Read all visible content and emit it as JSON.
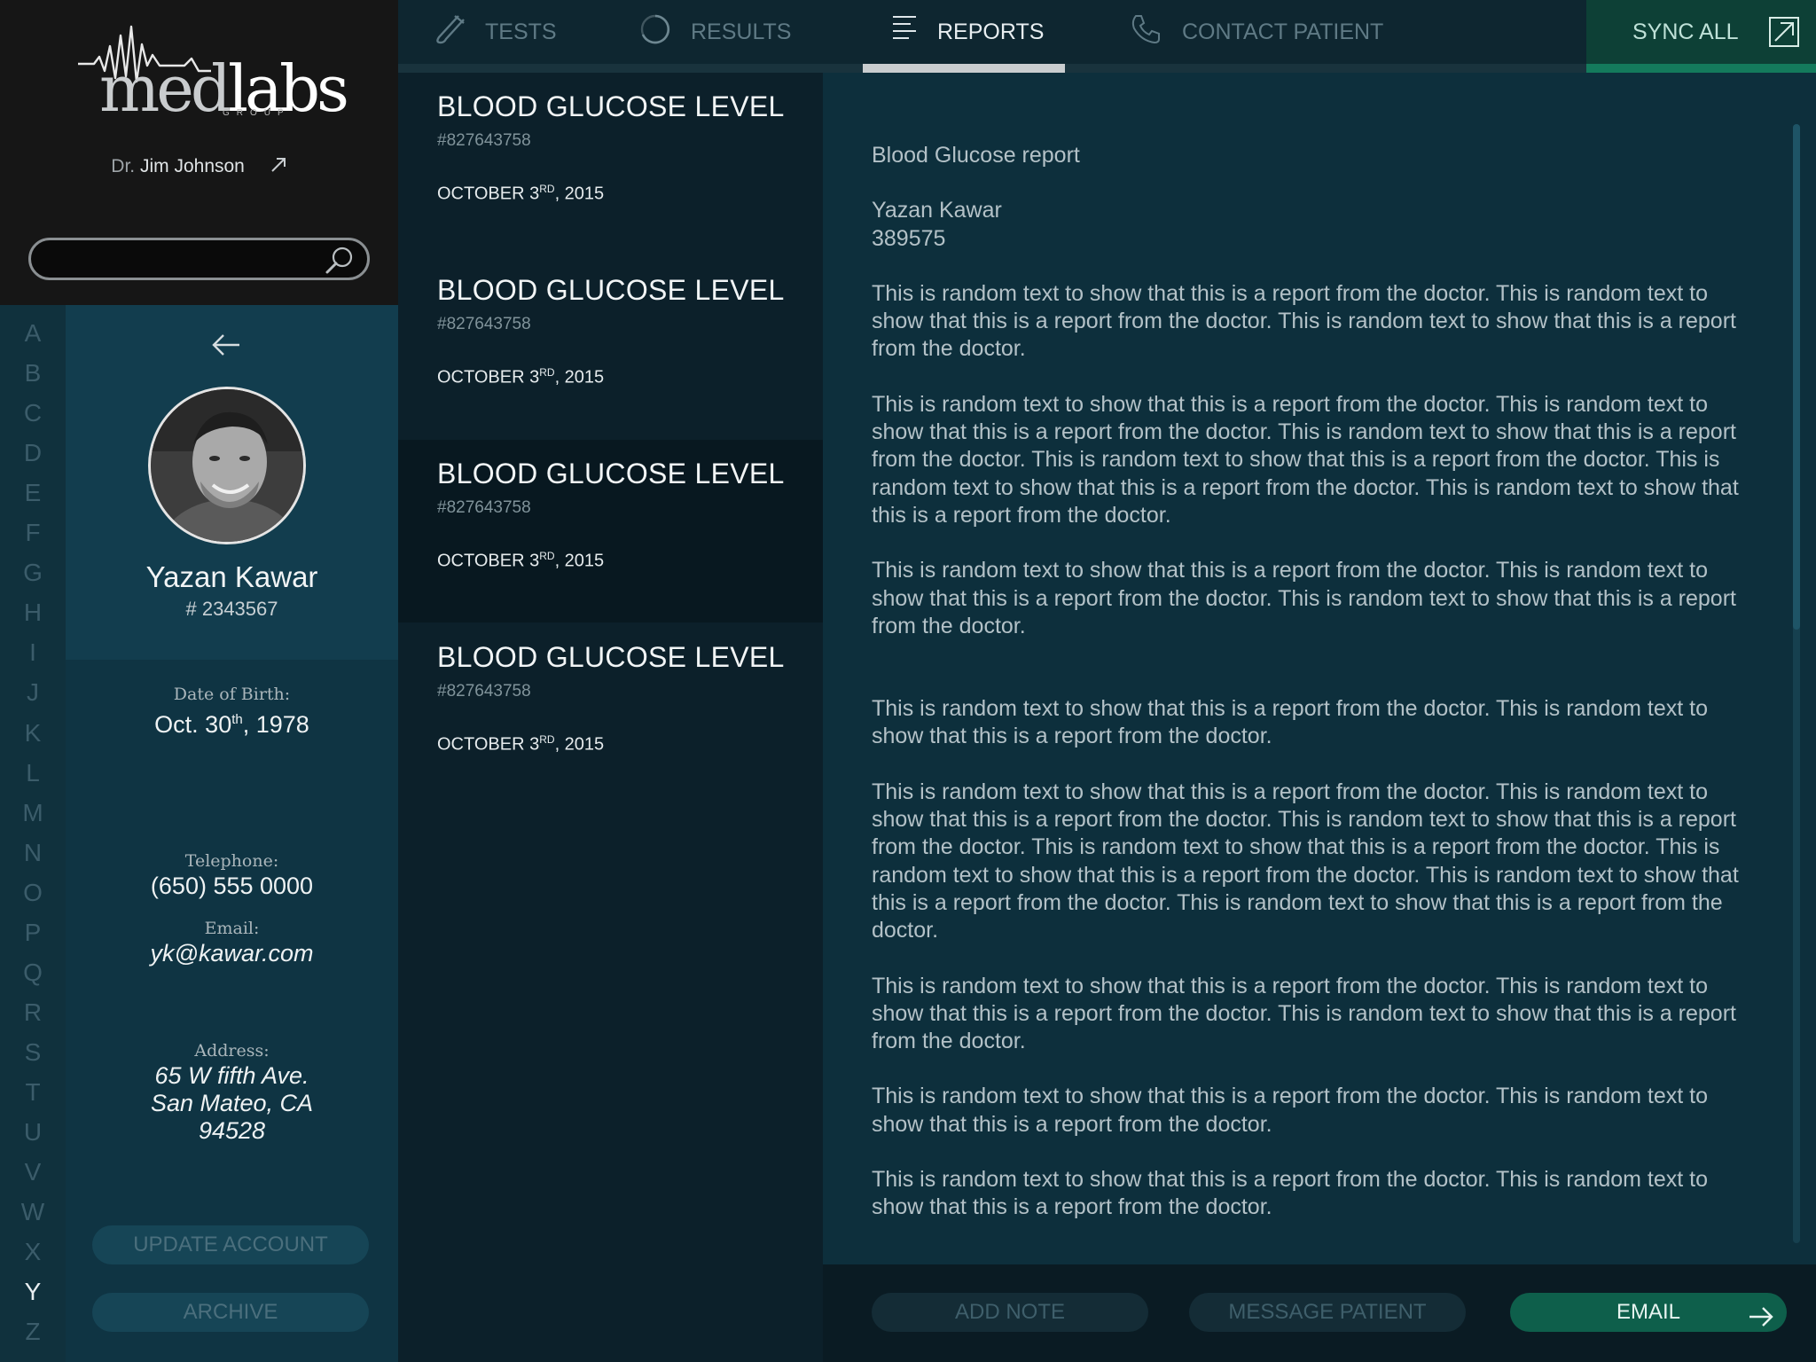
{
  "brand": {
    "logo_primary": "med",
    "logo_secondary": "labs",
    "logo_sub": "GROUP",
    "doctor_prefix": "Dr.",
    "doctor_name": "Jim Johnson",
    "search_placeholder": "",
    "search_value": ""
  },
  "alphabet": {
    "letters": [
      "A",
      "B",
      "C",
      "D",
      "E",
      "F",
      "G",
      "H",
      "I",
      "J",
      "K",
      "L",
      "M",
      "N",
      "O",
      "P",
      "Q",
      "R",
      "S",
      "T",
      "U",
      "V",
      "W",
      "X",
      "Y",
      "Z"
    ],
    "active": "Y"
  },
  "patient": {
    "name": "Yazan Kawar",
    "id": "# 2343567",
    "dob_label": "Date of Birth:",
    "dob_day": "Oct. 30",
    "dob_sup": "th",
    "dob_year": ", 1978",
    "phone_label": "Telephone:",
    "phone": "(650) 555 0000",
    "email_label": "Email:",
    "email": "yk@kawar.com",
    "address_label": "Address:",
    "address_line1": "65 W fifth Ave.",
    "address_line2": "San Mateo, CA",
    "address_line3": "94528",
    "update_button": "UPDATE ACCOUNT",
    "archive_button": "ARCHIVE"
  },
  "nav": {
    "tabs": [
      {
        "label": "TESTS",
        "icon": "test-tube-icon"
      },
      {
        "label": "RESULTS",
        "icon": "progress-ring-icon"
      },
      {
        "label": "REPORTS",
        "icon": "document-lines-icon"
      },
      {
        "label": "CONTACT PATIENT",
        "icon": "phone-icon"
      }
    ],
    "active": "REPORTS",
    "sync_label": "SYNC ALL"
  },
  "reports": [
    {
      "title": "BLOOD GLUCOSE LEVEL",
      "id": "#827643758",
      "date_day": "OCTOBER 3",
      "date_sup": "RD",
      "date_year": ", 2015",
      "active": false
    },
    {
      "title": "BLOOD GLUCOSE LEVEL",
      "id": "#827643758",
      "date_day": "OCTOBER 3",
      "date_sup": "RD",
      "date_year": ", 2015",
      "active": false
    },
    {
      "title": "BLOOD GLUCOSE LEVEL",
      "id": "#827643758",
      "date_day": "OCTOBER 3",
      "date_sup": "RD",
      "date_year": ", 2015",
      "active": true
    },
    {
      "title": "BLOOD GLUCOSE LEVEL",
      "id": "#827643758",
      "date_day": "OCTOBER 3",
      "date_sup": "RD",
      "date_year": ", 2015",
      "active": false
    }
  ],
  "detail": {
    "heading": "Blood Glucose report",
    "patient_name": "Yazan Kawar",
    "patient_number": "389575",
    "paragraphs": [
      "This is random text to show that this is a report from the doctor. This is random text to show that this is a report from the doctor. This is random text to show that this is a report from the doctor.",
      "This is random text to show that this is a report from the doctor. This is random text to show that this is a report from the doctor. This is random text to show that this is a report from the doctor. This is random text to show that this is a report from the doctor. This is random text to show that this is a report from the doctor. This is random text to show that this is a report from the doctor.",
      "This is random text to show that this is a report from the doctor. This is random text to show that this is a report from the doctor. This is random text to show that this is a report from the doctor.",
      "This is random text to show that this is a report from the doctor. This is random text to show that this is a report from the doctor.",
      "This is random text to show that this is a report from the doctor. This is random text to show that this is a report from the doctor. This is random text to show that this is a report from the doctor. This is random text to show that this is a report from the doctor. This is random text to show that this is a report from the doctor. This is random text to show that this is a report from the doctor. This is random text to show that this is a report from the doctor.",
      "This is random text to show that this is a report from the doctor. This is random text to show that this is a report from the doctor. This is random text to show that this is a report from the doctor.",
      "This is random text to show that this is a report from the doctor. This is random text to show that this is a report from the doctor.",
      "This is random text to show that this is a report from the doctor. This is random text to show that this is a report from the doctor."
    ],
    "scroll_fraction": 0.45
  },
  "actions": {
    "add_note": "ADD NOTE",
    "message_patient": "MESSAGE PATIENT",
    "email": "EMAIL"
  },
  "colors": {
    "sync_green": "#0d4036",
    "email_green": "#0e5f4b",
    "active_underline": "#c9cdcf",
    "panel_teal": "#0f3443"
  }
}
